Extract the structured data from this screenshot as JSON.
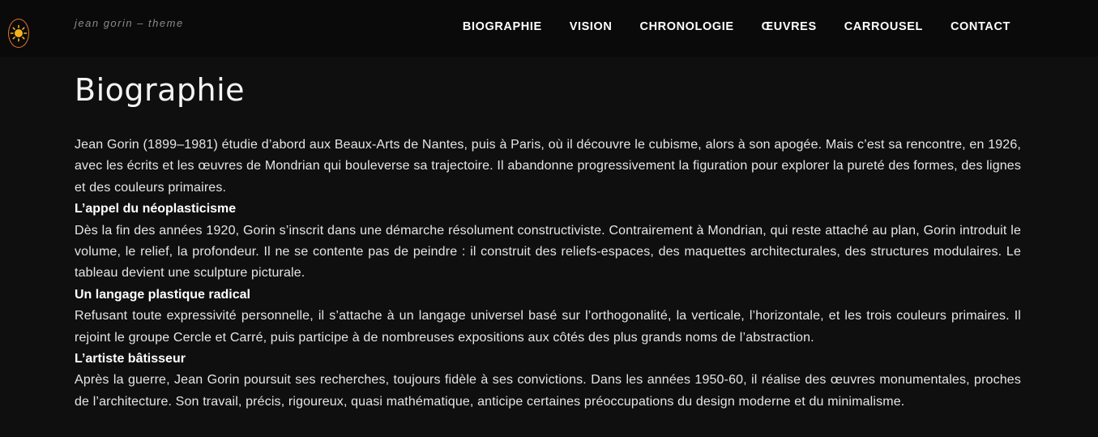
{
  "header": {
    "tagline": "jean gorin – theme",
    "logo_icon": "sun-icon",
    "accent_color": "#e8732a",
    "nav": [
      {
        "label": "BIOGRAPHIE"
      },
      {
        "label": "VISION"
      },
      {
        "label": "CHRONOLOGIE"
      },
      {
        "label": "ŒUVRES"
      },
      {
        "label": "CARROUSEL"
      },
      {
        "label": "CONTACT"
      }
    ]
  },
  "main": {
    "title": "Biographie",
    "intro": "Jean Gorin (1899–1981) étudie d’abord aux Beaux-Arts de Nantes, puis à Paris, où il découvre le cubisme, alors à son apogée. Mais c’est sa rencontre, en 1926, avec les écrits et les œuvres de Mondrian qui bouleverse sa trajectoire. Il abandonne progressivement la figuration pour explorer la pureté des formes, des lignes et des couleurs primaires.",
    "sections": [
      {
        "heading": "L’appel du néoplasticisme",
        "text": "Dès la fin des années 1920, Gorin s’inscrit dans une démarche résolument constructiviste. Contrairement à Mondrian, qui reste attaché au plan, Gorin introduit le volume, le relief, la profondeur. Il ne se contente pas de peindre : il construit des reliefs-espaces, des maquettes architecturales, des structures modulaires. Le tableau devient une sculpture picturale."
      },
      {
        "heading": "Un langage plastique radical",
        "text": "Refusant toute expressivité personnelle, il s’attache à un langage universel basé sur l’orthogonalité, la verticale, l’horizontale, et les trois couleurs primaires. Il rejoint le groupe Cercle et Carré, puis participe à de nombreuses expositions aux côtés des plus grands noms de l’abstraction."
      },
      {
        "heading": "L’artiste bâtisseur",
        "text": "Après la guerre, Jean Gorin poursuit ses recherches, toujours fidèle à ses convictions. Dans les années 1950-60, il réalise des œuvres monumentales, proches de l’architecture. Son travail, précis, rigoureux, quasi mathématique, anticipe certaines préoccupations du design moderne et du minimalisme."
      }
    ]
  }
}
